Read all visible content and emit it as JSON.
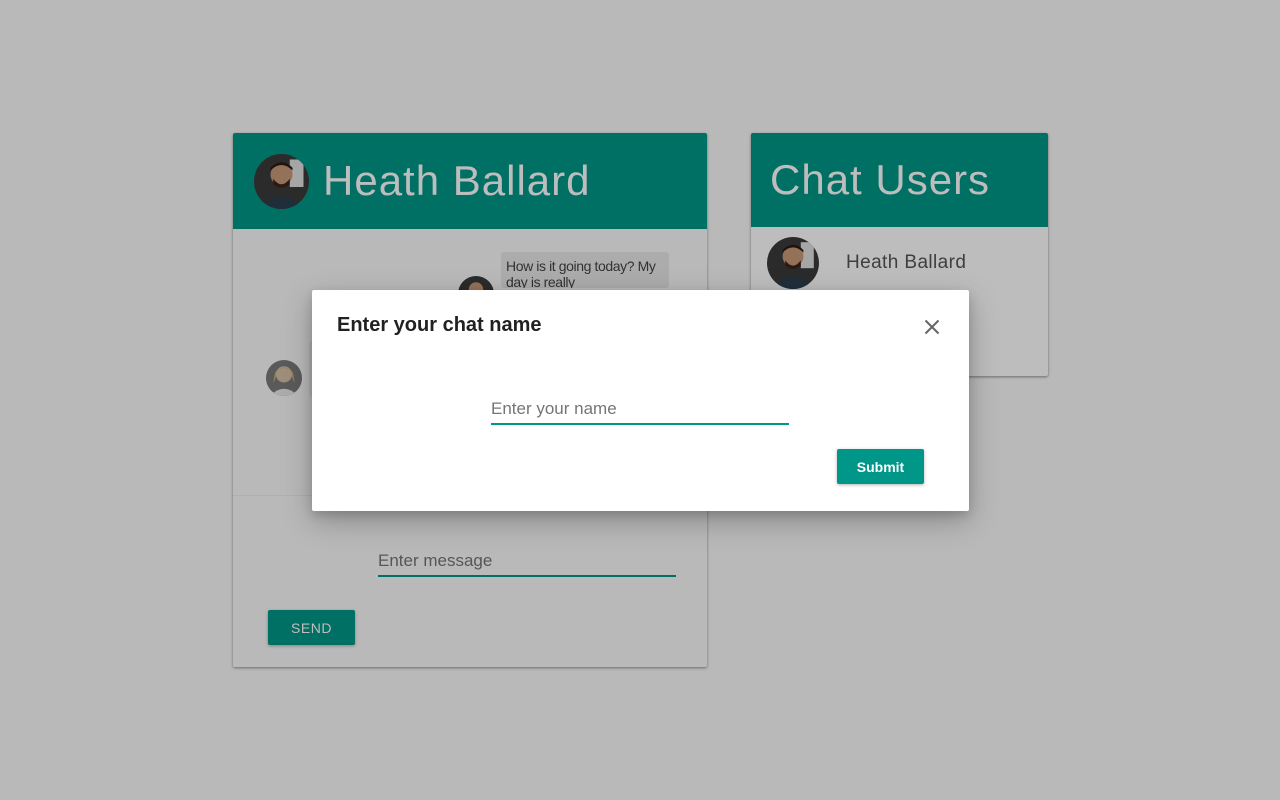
{
  "chat": {
    "header_name": "Heath Ballard",
    "messages": [
      {
        "text": "How is it going today? My day is really"
      }
    ],
    "message_placeholder": "Enter message",
    "send_label": "SEND"
  },
  "users_panel": {
    "title": "Chat Users",
    "users": [
      {
        "name": "Heath Ballard"
      }
    ]
  },
  "dialog": {
    "title": "Enter your chat name",
    "name_placeholder": "Enter your name",
    "submit_label": "Submit"
  },
  "colors": {
    "primary": "#009688",
    "backdrop": "rgba(0,0,0,0.26)"
  },
  "icons": {
    "close": "close-icon",
    "avatar": "avatar-photo"
  }
}
